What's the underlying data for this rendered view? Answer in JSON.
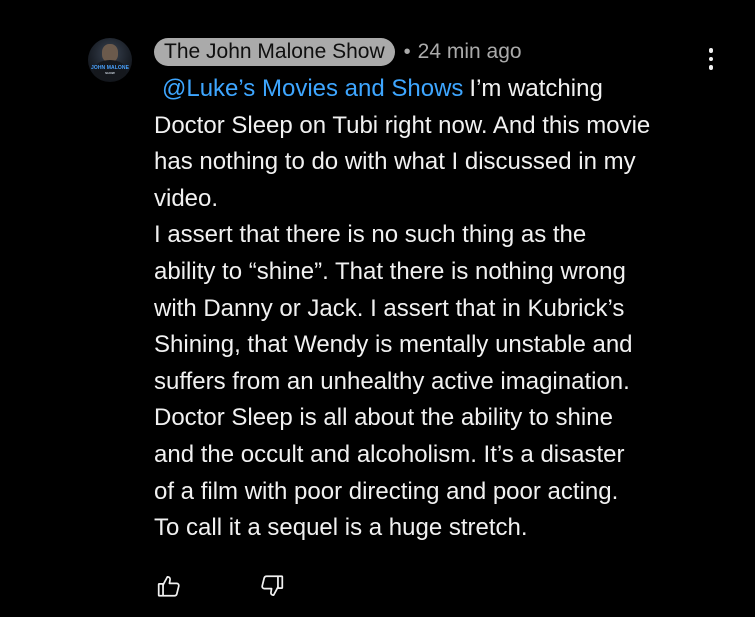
{
  "comment": {
    "avatar": {
      "logo_line1": "JOHN MALONE",
      "logo_line2": "SHOW"
    },
    "author": "The John Malone Show",
    "separator": "•",
    "time": "24 min ago",
    "mention": "@Luke’s Movies and Shows",
    "lines": [
      "I’m watching",
      "Doctor Sleep on Tubi right now. And this movie",
      "has nothing to do with what I discussed in my",
      "video.",
      "I assert that there is no such thing as the",
      "ability to “shine”. That there is nothing wrong",
      "with Danny or Jack. I assert that in Kubrick’s",
      "Shining, that Wendy is mentally unstable and",
      "suffers from an unhealthy active imagination.",
      "Doctor Sleep is all about the ability to shine",
      "and the occult and alcoholism. It’s a disaster",
      "of a film with poor directing and poor acting.",
      "To call it a sequel is a huge stretch."
    ],
    "actions": {
      "like_icon": "thumbs-up-icon",
      "dislike_icon": "thumbs-down-icon",
      "menu_icon": "more-vertical-icon"
    }
  },
  "colors": {
    "background": "#000000",
    "text": "#f1f1f1",
    "secondary_text": "#aaaaaa",
    "mention": "#3ea6ff",
    "author_chip": "#aaaaaa"
  }
}
